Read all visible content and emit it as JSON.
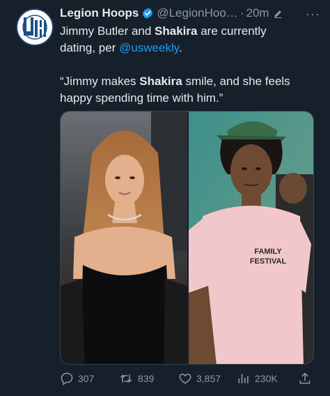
{
  "author": {
    "display_name": "Legion Hoops",
    "handle": "@LegionHoo…",
    "separator": "·",
    "timestamp": "20m",
    "more": "···"
  },
  "tweet": {
    "line1_a": "Jimmy Butler and ",
    "line1_b": "Shakira",
    "line1_c": " are currently",
    "line2_a": "dating, per ",
    "mention": "@usweekly",
    "line2_c": ".",
    "quote_a": "“Jimmy makes ",
    "quote_b": "Shakira",
    "quote_c": " smile, and she feels",
    "quote_line2": "happy spending time with him.”"
  },
  "media": {
    "left_photo": "Shakira on red carpet",
    "right_photo": "Jimmy Butler in pink shirt",
    "shirt_text_1": "FAMILY",
    "shirt_text_2": "FESTIVAL"
  },
  "actions": {
    "replies": "307",
    "reposts": "839",
    "likes": "3,857",
    "views": "230K"
  },
  "colors": {
    "background": "#15202b",
    "text": "#e7e9ea",
    "secondary": "#8b98a5",
    "accent": "#1d9bf0"
  },
  "icons": {
    "verified": "verified-badge-icon",
    "edit": "edit-pencil-icon",
    "reply": "reply-icon",
    "repost": "repost-icon",
    "like": "like-icon",
    "views": "views-icon",
    "share": "share-icon"
  }
}
